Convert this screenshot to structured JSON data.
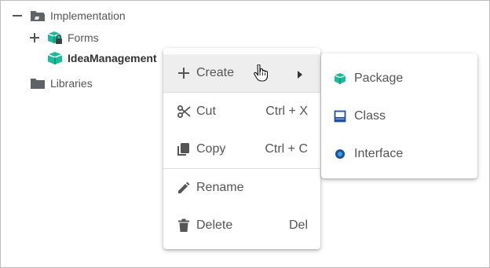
{
  "tree": {
    "root": {
      "label": "Implementation",
      "toggle": "—"
    },
    "forms": {
      "label": "Forms",
      "toggle": "+"
    },
    "idea": {
      "label": "IdeaManagement"
    },
    "libraries": {
      "label": "Libraries"
    }
  },
  "context_menu": {
    "create": {
      "label": "Create"
    },
    "cut": {
      "label": "Cut",
      "shortcut": "Ctrl + X"
    },
    "copy": {
      "label": "Copy",
      "shortcut": "Ctrl + C"
    },
    "rename": {
      "label": "Rename"
    },
    "delete": {
      "label": "Delete",
      "shortcut": "Del"
    }
  },
  "submenu": {
    "package": {
      "label": "Package"
    },
    "class": {
      "label": "Class"
    },
    "interface": {
      "label": "Interface"
    }
  },
  "colors": {
    "teal": "#1bbc9b",
    "blue": "#1e4fa0",
    "folder": "#5f6368"
  }
}
